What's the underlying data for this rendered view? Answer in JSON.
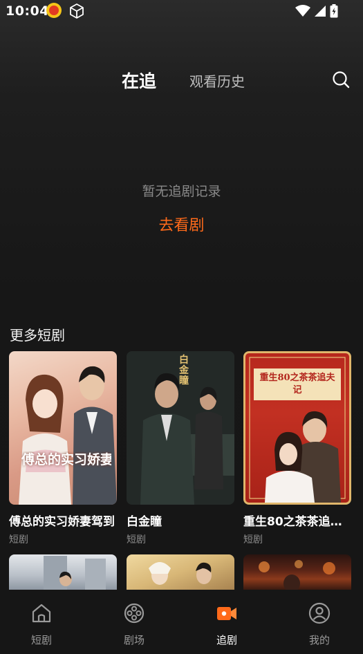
{
  "status_bar": {
    "time": "10:04",
    "icons": [
      "app-notification-icon",
      "box-icon",
      "wifi-icon",
      "signal-icon",
      "battery-icon"
    ]
  },
  "top_tabs": {
    "active": "在追",
    "history": "观看历史"
  },
  "empty_state": {
    "message": "暂无追剧记录",
    "action": "去看剧"
  },
  "section": {
    "title": "更多短剧"
  },
  "dramas": [
    {
      "title": "傅总的实习娇妻驾到",
      "category": "短剧",
      "poster_text": "傅总的实习娇妻驾到"
    },
    {
      "title": "白金瞳",
      "category": "短剧",
      "poster_text": "白金瞳"
    },
    {
      "title": "重生80之茶茶追夫记",
      "category": "短剧",
      "poster_text": "重生80之茶茶追夫记"
    }
  ],
  "bottom_nav": [
    {
      "label": "短剧",
      "icon": "home-icon",
      "active": false
    },
    {
      "label": "剧场",
      "icon": "film-reel-icon",
      "active": false
    },
    {
      "label": "追剧",
      "icon": "video-camera-icon",
      "active": true
    },
    {
      "label": "我的",
      "icon": "profile-icon",
      "active": false
    }
  ],
  "colors": {
    "accent": "#ff6a1a",
    "background": "#161616",
    "muted_text": "#8a8a8a"
  }
}
